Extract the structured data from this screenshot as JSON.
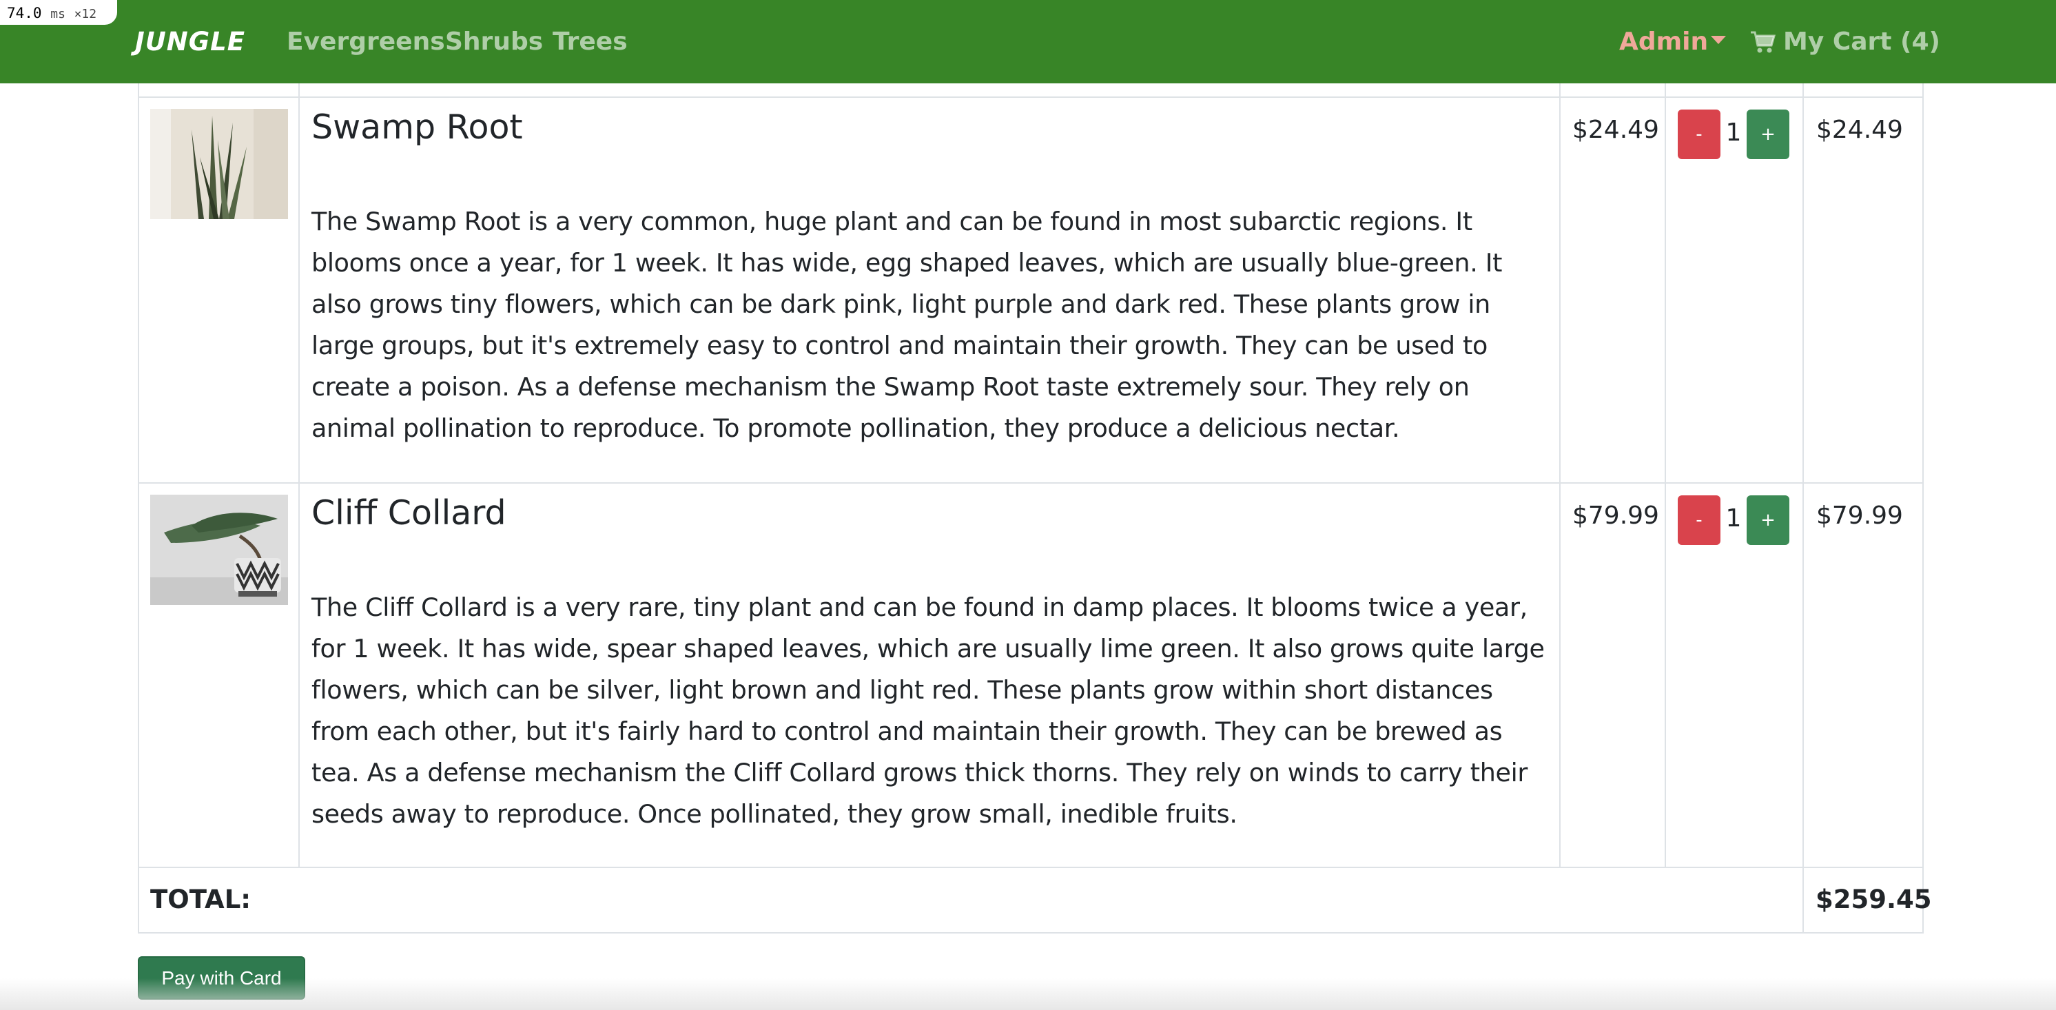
{
  "perf": {
    "value": "74.0",
    "unit": "ms",
    "multiplier": "×12"
  },
  "navbar": {
    "brand": "JUNGLE",
    "links": [
      "Evergreens",
      "Shrubs",
      "Trees"
    ],
    "admin": "Admin",
    "cart": "My Cart (4)",
    "background_color": "#388527"
  },
  "cart": {
    "items": [
      {
        "name": "Swamp Root",
        "description": "The Swamp Root is a very common, huge plant and can be found in most subarctic regions. It blooms once a year, for 1 week. It has wide, egg shaped leaves, which are usually blue-green. It also grows tiny flowers, which can be dark pink, light purple and dark red. These plants grow in large groups, but it's extremely easy to control and maintain their growth. They can be used to create a poison. As a defense mechanism the Swamp Root taste extremely sour. They rely on animal pollination to reproduce. To promote pollination, they produce a delicious nectar.",
        "price": "$24.49",
        "quantity": "1",
        "subtotal": "$24.49",
        "decrement_label": "-",
        "increment_label": "+"
      },
      {
        "name": "Cliff Collard",
        "description": "The Cliff Collard is a very rare, tiny plant and can be found in damp places. It blooms twice a year, for 1 week. It has wide, spear shaped leaves, which are usually lime green. It also grows quite large flowers, which can be silver, light brown and light red. These plants grow within short distances from each other, but it's fairly hard to control and maintain their growth. They can be brewed as tea. As a defense mechanism the Cliff Collard grows thick thorns. They rely on winds to carry their seeds away to reproduce. Once pollinated, they grow small, inedible fruits.",
        "price": "$79.99",
        "quantity": "1",
        "subtotal": "$79.99",
        "decrement_label": "-",
        "increment_label": "+"
      }
    ],
    "total_label": "TOTAL:",
    "total_value": "$259.45",
    "pay_button": "Pay with Card"
  },
  "colors": {
    "decrement": "#d9434c",
    "increment": "#3b8a55",
    "pay": "#2f7a4f"
  }
}
